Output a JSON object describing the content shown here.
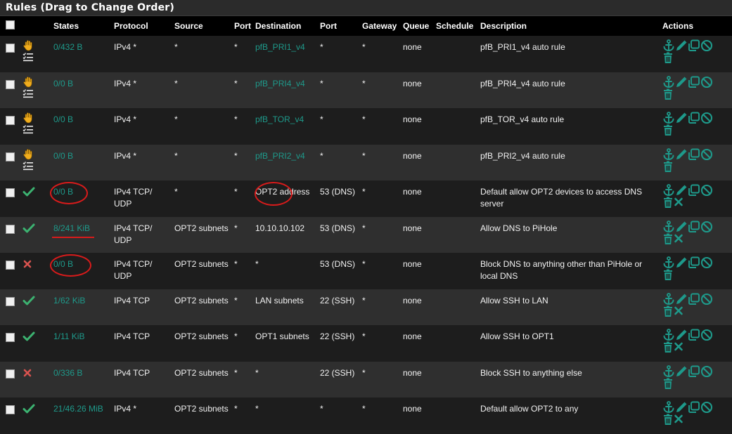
{
  "panel": {
    "title": "Rules (Drag to Change Order)"
  },
  "headers": {
    "states": "States",
    "protocol": "Protocol",
    "source": "Source",
    "src_port": "Port",
    "destination": "Destination",
    "dst_port": "Port",
    "gateway": "Gateway",
    "queue": "Queue",
    "schedule": "Schedule",
    "description": "Description",
    "actions": "Actions"
  },
  "colors": {
    "teal": "#1e9a8b",
    "green": "#3cb371",
    "red": "#d9534f",
    "hand": "#f0ad1e",
    "annotation": "#d91b1b"
  },
  "rows": [
    {
      "status": "hand",
      "states": "0/432 B",
      "protocol": "IPv4 *",
      "source": "*",
      "src_port": "*",
      "destination": "pfB_PRI1_v4",
      "dest_alias": true,
      "dst_port": "*",
      "gateway": "*",
      "queue": "none",
      "schedule": "",
      "description": "pfB_PRI1_v4 auto rule",
      "has_x": false
    },
    {
      "status": "hand",
      "states": "0/0 B",
      "protocol": "IPv4 *",
      "source": "*",
      "src_port": "*",
      "destination": "pfB_PRI4_v4",
      "dest_alias": true,
      "dst_port": "*",
      "gateway": "*",
      "queue": "none",
      "schedule": "",
      "description": "pfB_PRI4_v4 auto rule",
      "has_x": false
    },
    {
      "status": "hand",
      "states": "0/0 B",
      "protocol": "IPv4 *",
      "source": "*",
      "src_port": "*",
      "destination": "pfB_TOR_v4",
      "dest_alias": true,
      "dst_port": "*",
      "gateway": "*",
      "queue": "none",
      "schedule": "",
      "description": "pfB_TOR_v4 auto rule",
      "has_x": false
    },
    {
      "status": "hand",
      "states": "0/0 B",
      "protocol": "IPv4 *",
      "source": "*",
      "src_port": "*",
      "destination": "pfB_PRI2_v4",
      "dest_alias": true,
      "dst_port": "*",
      "gateway": "*",
      "queue": "none",
      "schedule": "",
      "description": "pfB_PRI2_v4 auto rule",
      "has_x": false
    },
    {
      "status": "pass",
      "states": "0/0 B",
      "protocol": "IPv4 TCP/ UDP",
      "source": "*",
      "src_port": "*",
      "destination": "OPT2 address",
      "dest_alias": false,
      "dst_port": "53 (DNS)",
      "gateway": "*",
      "queue": "none",
      "schedule": "",
      "description": "Default allow OPT2 devices to access DNS server",
      "has_x": true
    },
    {
      "status": "pass",
      "states": "8/241 KiB",
      "protocol": "IPv4 TCP/ UDP",
      "source": "OPT2 subnets",
      "src_port": "*",
      "destination": "10.10.10.102",
      "dest_alias": false,
      "dst_port": "53 (DNS)",
      "gateway": "*",
      "queue": "none",
      "schedule": "",
      "description": "Allow DNS to PiHole",
      "has_x": true
    },
    {
      "status": "block",
      "states": "0/0 B",
      "protocol": "IPv4 TCP/ UDP",
      "source": "OPT2 subnets",
      "src_port": "*",
      "destination": "*",
      "dest_alias": false,
      "dst_port": "53 (DNS)",
      "gateway": "*",
      "queue": "none",
      "schedule": "",
      "description": "Block DNS to anything other than PiHole or local DNS",
      "has_x": false
    },
    {
      "status": "pass",
      "states": "1/62 KiB",
      "protocol": "IPv4 TCP",
      "source": "OPT2 subnets",
      "src_port": "*",
      "destination": "LAN subnets",
      "dest_alias": false,
      "dst_port": "22 (SSH)",
      "gateway": "*",
      "queue": "none",
      "schedule": "",
      "description": "Allow SSH to LAN",
      "has_x": true
    },
    {
      "status": "pass",
      "states": "1/11 KiB",
      "protocol": "IPv4 TCP",
      "source": "OPT2 subnets",
      "src_port": "*",
      "destination": "OPT1 subnets",
      "dest_alias": false,
      "dst_port": "22 (SSH)",
      "gateway": "*",
      "queue": "none",
      "schedule": "",
      "description": "Allow SSH to OPT1",
      "has_x": true
    },
    {
      "status": "block",
      "states": "0/336 B",
      "protocol": "IPv4 TCP",
      "source": "OPT2 subnets",
      "src_port": "*",
      "destination": "*",
      "dest_alias": false,
      "dst_port": "22 (SSH)",
      "gateway": "*",
      "queue": "none",
      "schedule": "",
      "description": "Block SSH to anything else",
      "has_x": false
    },
    {
      "status": "pass",
      "states": "21/46.26 MiB",
      "protocol": "IPv4 *",
      "source": "OPT2 subnets",
      "src_port": "*",
      "destination": "*",
      "dest_alias": false,
      "dst_port": "*",
      "gateway": "*",
      "queue": "none",
      "schedule": "",
      "description": "Default allow OPT2 to any",
      "has_x": true
    }
  ]
}
